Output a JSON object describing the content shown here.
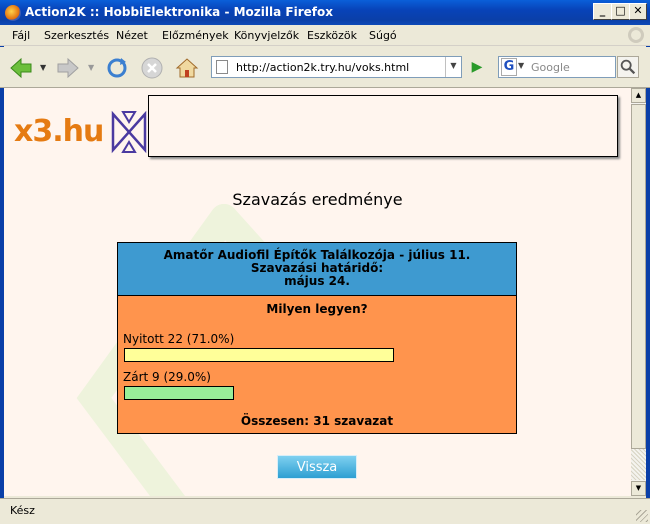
{
  "window": {
    "title": "Action2K :: HobbiElektronika - Mozilla Firefox"
  },
  "menu": [
    "Fájl",
    "Szerkesztés",
    "Nézet",
    "Előzmények",
    "Könyvjelzők",
    "Eszközök",
    "Súgó"
  ],
  "nav": {
    "url": "http://action2k.try.hu/voks.html",
    "search_placeholder": "Google",
    "search_engine_icon": "G"
  },
  "page": {
    "logo_text": "x3.hu",
    "heading": "Szavazás eredménye",
    "poll": {
      "title_line1": "Amatőr Audiofil Építők Találkozója - július 11.",
      "title_line2": "Szavazási határidő:",
      "title_line3": "május 24.",
      "question": "Milyen legyen?",
      "options": [
        {
          "label": "Nyitott 22 (71.0%)",
          "votes": 22,
          "percent": 71.0,
          "color": "#ffff99"
        },
        {
          "label": "Zárt 9 (29.0%)",
          "votes": 9,
          "percent": 29.0,
          "color": "#99ee99"
        }
      ],
      "total": "Összesen: 31 szavazat"
    },
    "back_button": "Vissza"
  },
  "status": {
    "text": "Kész"
  },
  "colors": {
    "poll_header": "#3e9ad0",
    "poll_body": "#ff944d",
    "page_bg": "#fff5ee",
    "logo_orange": "#e57b12"
  }
}
